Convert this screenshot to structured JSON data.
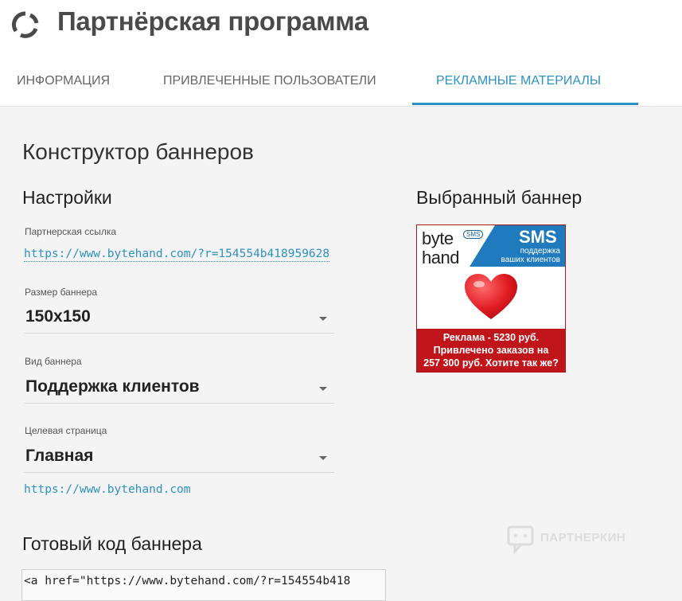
{
  "header": {
    "title": "Партнёрская программа",
    "tabs": [
      {
        "label": "ИНФОРМАЦИЯ",
        "active": false
      },
      {
        "label": "ПРИВЛЕЧЕННЫЕ ПОЛЬЗОВАТЕЛИ",
        "active": false
      },
      {
        "label": "РЕКЛАМНЫЕ МАТЕРИАЛЫ",
        "active": true
      }
    ]
  },
  "section_title": "Конструктор баннеров",
  "settings": {
    "title": "Настройки",
    "partner_link_label": "Партнерская ссылка",
    "partner_link": "https://www.bytehand.com/?r=154554b418959628",
    "size_label": "Размер баннера",
    "size_value": "150x150",
    "type_label": "Вид баннера",
    "type_value": "Поддержка клиентов",
    "target_label": "Целевая страница",
    "target_value": "Главная",
    "target_url": "https://www.bytehand.com"
  },
  "code": {
    "title": "Готовый код баннера",
    "value": "<a href=\"https://www.bytehand.com/?r=154554b418"
  },
  "preview": {
    "title": "Выбранный баннер",
    "banner": {
      "word1": "byte",
      "word2": "hand",
      "badge": "SMS",
      "sms": "SMS",
      "sub1": "поддержка",
      "sub2": "ваших клиентов",
      "line1": "Реклама - 5230 руб.",
      "line2": "Привлечено заказов на",
      "line3": "257 300 руб. Хотите так же?"
    }
  },
  "watermark": "ПАРТНЕРКИН",
  "colors": {
    "accent": "#2d91c2",
    "banner_blue": "#1f7bbd",
    "banner_red": "#c0151a",
    "heart": "#e01b22"
  },
  "icons": {
    "logo": "circular-arrows-icon",
    "dropdown": "caret-down-icon",
    "heart": "heart-icon",
    "watermark": "chat-bubble-icon"
  }
}
